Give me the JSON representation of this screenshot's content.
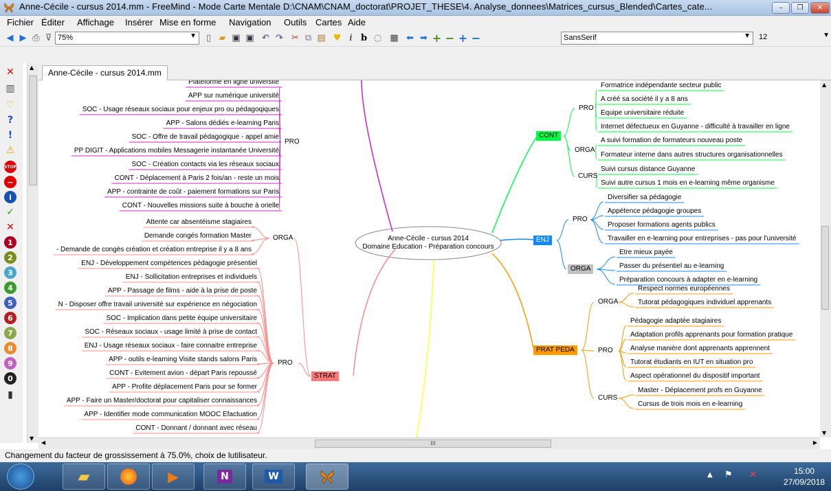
{
  "window": {
    "title": "Anne-Cécile - cursus 2014.mm - FreeMind - Mode Carte Mentale D:\\CNAM\\CNAM_doctorat\\PROJET_THESE\\4. Analyse_donnees\\Matrices_cursus_Blended\\Cartes_cate...",
    "minimize": "–",
    "maximize": "❐",
    "close": "✕"
  },
  "menu": [
    "Fichier",
    "Éditer",
    "Affichage",
    "Insérer",
    "Mise en forme",
    "Navigation",
    "Outils",
    "Cartes",
    "Aide"
  ],
  "toolbar": {
    "zoom": "75%",
    "font": "SansSerif",
    "font_size": "12"
  },
  "tab": {
    "label": "Anne-Cécile - cursus 2014.mm"
  },
  "status": "Changement du facteur de grossissement à 75.0%, choix de lutilisateur.",
  "clock": {
    "time": "15:00",
    "date": "27/09/2018"
  },
  "center": {
    "line1": "Anne-Cécile - cursus 2014",
    "line2": "Domaine Education - Préparation concours"
  },
  "left": {
    "pro1": {
      "label": "PRO",
      "items": [
        "Plateforme en ligne université",
        "APP sur numérique université",
        "SOC - Usage réseaux sociaux pour enjeux pro ou pédagoqiques",
        "APP - Salons dédiés e-learning Paris",
        "SOC - Offre de travail pédagogique - appel amie",
        "PP DIGIT - Applications mobiles Messagerie instantanée Université",
        "SOC - Création contacts via les réseaux sociaux",
        "CONT - Déplacement à Paris 2 fois/an - reste un mois",
        "APP - contrainte de coût - paiement formations sur Paris",
        "CONT - Nouvelles missions suite à bouche à orielle"
      ]
    },
    "strat": {
      "label": "STRAT",
      "orga": {
        "label": "ORGA",
        "items": [
          "Attente car absentéisme stagiaires",
          "Demande congés formation Master",
          "- Demande de congès création et création entreprise il y a 8 ans"
        ]
      },
      "pro": {
        "label": "PRO",
        "items": [
          "ENJ - Développement compétences pédagogie présentiel",
          "ENJ - Sollicitation entreprises et individuels",
          "APP - Passage de films - aide à la prise de poste",
          "N - Disposer offre travail université sur expérience en négociation",
          "SOC - Implication dans petite équipe universitaire",
          "SOC - Réseaux sociaux - usage limité à prise de contact",
          "ENJ - Usage réseaux sociaux - faire connaitre entreprise",
          "APP - outils e-learning Visite stands salons Paris",
          "CONT - Evitement avion - départ Paris repoussé",
          "APP - Profite déplacement Paris pour se former",
          "APP - Faire un Master/doctorat pour capitaliser connaissances",
          "APP - Identifier mode communication MOOC Efactuation",
          "CONT - Donnant / donnant avec réseau"
        ]
      }
    }
  },
  "right": {
    "cont": {
      "label": "CONT",
      "pro": {
        "label": "PRO",
        "items": [
          "Formatrice indépendante secteur public",
          "A créé sa société il y a 8 ans",
          "Equipe universitaire réduite",
          "Internet défectueux en Guyanne - difficulté à travailler en ligne"
        ]
      },
      "orga": {
        "label": "ORGA",
        "items": [
          "A suivi formation de formateurs nouveau poste",
          "Formateur interne dans autres structures organisationnelles"
        ]
      },
      "curs": {
        "label": "CURS",
        "items": [
          "Suivi cursus distance Guyanne",
          "Suivi autre cursus 1 mois en e-learning même organisme"
        ]
      }
    },
    "enj": {
      "label": "ENJ",
      "pro": {
        "label": "PRO",
        "items": [
          "Diversifier sa pédagogie",
          "Appétence pédagogie groupes",
          "Proposer formations agents publics",
          "Travailler en e-learning pour entreprises - pas pour l'université"
        ]
      },
      "orga": {
        "label": "ORGA",
        "items": [
          "Etre mieux payée",
          "Passer du présentiel au e-learning",
          "Préparation concours à adapter en e-learning"
        ]
      }
    },
    "prat": {
      "label": "PRAT PEDA",
      "orga": {
        "label": "ORGA",
        "items": [
          "Respect normes européennes",
          "Tutorat pédagogiques individuel apprenants"
        ]
      },
      "pro": {
        "label": "PRO",
        "items": [
          "Pédagogie adaptée stagiaires",
          "Adaptation profils apprenants pour formation pratique",
          "Analyse manière dont apprenants apprennent",
          "Tutorat étudiants en IUT en situation pro",
          "Aspect opérationnel du dispositif important"
        ]
      },
      "curs": {
        "label": "CURS",
        "items": [
          "Master - Déplacement profs en Guyanne",
          "Cursus de trois mois en e-learning"
        ]
      }
    }
  },
  "colors": {
    "cont": "#00ff44",
    "enj": "#1188ff",
    "prat": "#ff9900",
    "strat": "#ff8888",
    "pro1": "#cc22cc",
    "yellow": "#ffff33",
    "orga_enj": "#c0c0c0",
    "strat_bg": "#ff7777"
  }
}
